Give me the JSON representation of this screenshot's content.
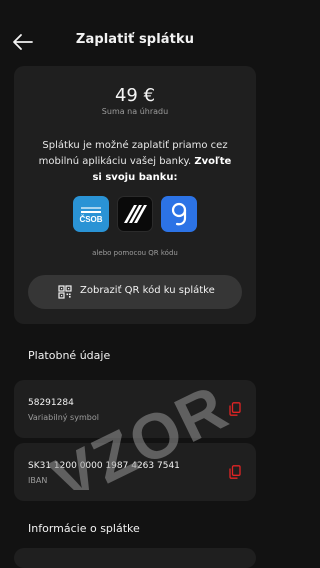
{
  "header": {
    "title": "Zaplatiť splátku",
    "back_icon": "arrow-left-icon"
  },
  "payment": {
    "amount": "49 €",
    "amount_caption": "Suma na úhradu",
    "info_text": "Splátku je možné zaplatiť priamo cez mobilnú aplikáciu vašej banky.",
    "info_cta": "Zvoľte si svoju banku:",
    "banks": [
      {
        "name": "ČSOB",
        "icon": "csob-bank-icon",
        "color": "#2a93d5"
      },
      {
        "name": "Tatra banka",
        "icon": "tatra-bank-icon",
        "color": "#0a0a0a"
      },
      {
        "name": "George",
        "icon": "george-bank-icon",
        "color": "#2c73e6"
      }
    ],
    "qr_alternative": "alebo pomocou QR kódu",
    "qr_button_label": "Zobraziť QR kód ku splátke",
    "qr_icon": "qr-code-icon"
  },
  "payment_details": {
    "title": "Platobné údaje",
    "rows": [
      {
        "value": "58291284",
        "label": "Variabilný symbol",
        "icon": "copy-icon"
      },
      {
        "value": "SK31 1200 0000 1987 4263 7541",
        "label": "IBAN",
        "icon": "copy-icon"
      }
    ]
  },
  "installment_info": {
    "title": "Informácie o splátke"
  },
  "watermark": "VZOR",
  "colors": {
    "background": "#121212",
    "card": "#1f1f1f",
    "button": "#363636",
    "accent_icon": "#e02424"
  }
}
